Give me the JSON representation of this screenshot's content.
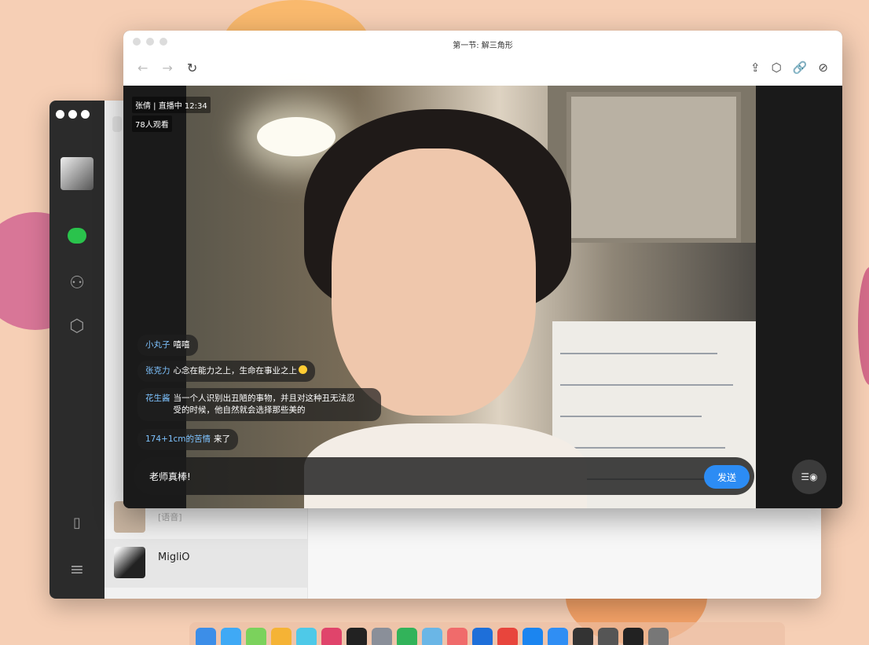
{
  "live": {
    "title": "第一节: 解三角形",
    "nav_back": "←",
    "nav_forward": "→",
    "nav_reload": "↻",
    "tool_share": "⇪",
    "tool_box": "⬡",
    "tool_link": "🔗",
    "tool_compass": "⊘",
    "streamer_status": "张倩 | 直播中 12:34",
    "viewers": "78人观看",
    "comments": [
      {
        "user": "小丸子",
        "text": "嘻嘻"
      },
      {
        "user": "张克力",
        "text": "心念在能力之上，生命在事业之上"
      },
      {
        "user": "花生酱",
        "text": "当一个人识别出丑陋的事物，并且对这种丑无法忍受的时候，他自然就会选择那些美的"
      },
      {
        "user": "174+1cm的苦情",
        "text": "来了"
      }
    ],
    "input_text": "老师真棒!",
    "send_label": "发送",
    "eye_icon_glyph": "☰◉"
  },
  "messenger": {
    "contacts": [
      {
        "name": "",
        "sub": "[语音]"
      },
      {
        "name": "MigliO",
        "sub": ""
      }
    ]
  },
  "colors": {
    "accent": "#2c8cf4",
    "username": "#7ec3ff",
    "chat_green": "#2ac34c"
  }
}
